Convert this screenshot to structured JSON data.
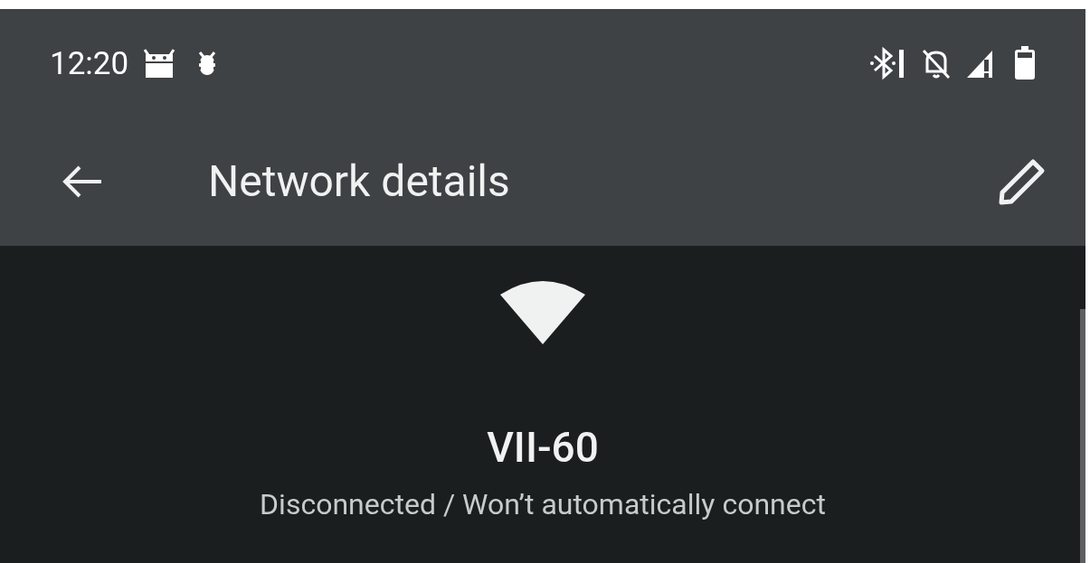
{
  "status_bar": {
    "time": "12:20"
  },
  "app_bar": {
    "title": "Network details"
  },
  "network": {
    "name": "VII-60",
    "status": "Disconnected / Won’t automatically connect"
  }
}
